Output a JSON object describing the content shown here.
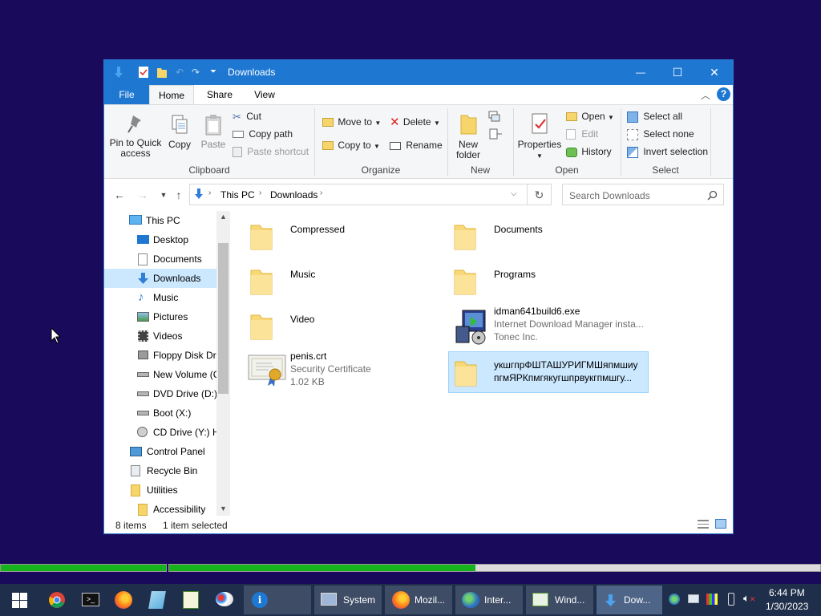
{
  "window": {
    "title": "Downloads",
    "controls": {
      "minimize": "—",
      "maximize": "☐",
      "close": "✕"
    }
  },
  "ribbon_tabs": [
    {
      "label": "File"
    },
    {
      "label": "Home"
    },
    {
      "label": "Share"
    },
    {
      "label": "View"
    }
  ],
  "ribbon": {
    "clipboard": {
      "pin_label_1": "Pin to Quick",
      "pin_label_2": "access",
      "copy": "Copy",
      "paste": "Paste",
      "cut": "Cut",
      "copy_path": "Copy path",
      "paste_shortcut": "Paste shortcut",
      "group": "Clipboard"
    },
    "organize": {
      "move_to": "Move to",
      "copy_to": "Copy to",
      "delete": "Delete",
      "rename": "Rename",
      "group": "Organize"
    },
    "new": {
      "new_folder_1": "New",
      "new_folder_2": "folder",
      "group": "New"
    },
    "open": {
      "properties": "Properties",
      "open": "Open",
      "edit": "Edit",
      "history": "History",
      "group": "Open"
    },
    "select": {
      "select_all": "Select all",
      "select_none": "Select none",
      "invert": "Invert selection",
      "group": "Select"
    }
  },
  "address": {
    "crumbs": [
      "This PC",
      "Downloads"
    ],
    "search_placeholder": "Search Downloads"
  },
  "nav_items": [
    {
      "label": "This PC"
    },
    {
      "label": "Desktop"
    },
    {
      "label": "Documents"
    },
    {
      "label": "Downloads"
    },
    {
      "label": "Music"
    },
    {
      "label": "Pictures"
    },
    {
      "label": "Videos"
    },
    {
      "label": "Floppy Disk Dri"
    },
    {
      "label": "New Volume (C"
    },
    {
      "label": "DVD Drive (D:)"
    },
    {
      "label": "Boot (X:)"
    },
    {
      "label": "CD Drive (Y:) H"
    },
    {
      "label": "Control Panel"
    },
    {
      "label": "Recycle Bin"
    },
    {
      "label": "Utilities"
    },
    {
      "label": "Accessibility"
    }
  ],
  "files": [
    {
      "name": "Compressed"
    },
    {
      "name": "Documents"
    },
    {
      "name": "Music"
    },
    {
      "name": "Programs"
    },
    {
      "name": "Video"
    },
    {
      "name": "idman641build6.exe",
      "line2": "Internet Download Manager insta...",
      "line3": "Tonec Inc."
    },
    {
      "name": "penis.crt",
      "line2": "Security Certificate",
      "line3": "1.02 KB"
    },
    {
      "name": "укшгпрФШТАШУРИГМШяпмшиу",
      "line2": "пгмЯРКпмгякугшпрвукгпмшгу..."
    }
  ],
  "status": {
    "count": "8 items",
    "selected": "1 item selected"
  },
  "progress": [
    {
      "fill": 1.0
    },
    {
      "fill": 0.47
    }
  ],
  "taskbar": {
    "apps": [
      {
        "label": "System"
      },
      {
        "label": "Mozil..."
      },
      {
        "label": "Inter..."
      },
      {
        "label": "Wind..."
      },
      {
        "label": "Dow..."
      }
    ],
    "time": "6:44 PM",
    "date": "1/30/2023"
  },
  "colors": {
    "desktop": "#1a0a5c",
    "titlebar": "#1e78d2",
    "selection": "#cce8ff",
    "progress": "#16b31c"
  }
}
